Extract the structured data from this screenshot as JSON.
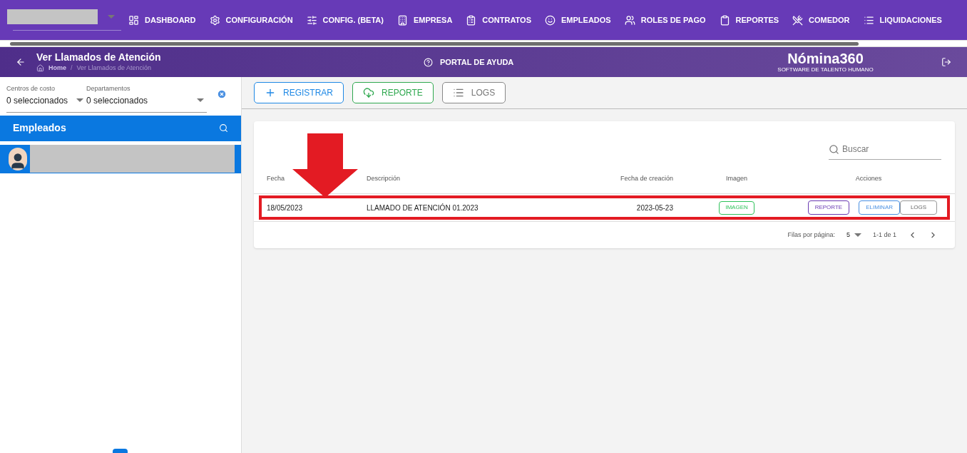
{
  "topbar": {
    "nav": [
      "DASHBOARD",
      "CONFIGURACIÓN",
      "CONFIG. (BETA)",
      "EMPRESA",
      "CONTRATOS",
      "EMPLEADOS",
      "ROLES DE PAGO",
      "REPORTES",
      "COMEDOR",
      "LIQUIDACIONES"
    ]
  },
  "header": {
    "title": "Ver Llamados de Atención",
    "breadcrumb": [
      "Home",
      "Ver Llamados de Atención"
    ],
    "breadcrumb_separator": "/",
    "help": "PORTAL DE AYUDA",
    "logo": "Nómina360",
    "logo_tagline": "SOFTWARE DE TALENTO HUMANO"
  },
  "filters": [
    {
      "label": "Centros de costo",
      "value": "0 seleccionados"
    },
    {
      "label": "Departamentos",
      "value": "0 seleccionados"
    }
  ],
  "sidebar": {
    "title": "Empleados",
    "employees": [
      {
        "selected": true
      }
    ]
  },
  "toolbar": [
    {
      "kind": "add",
      "label": "REGISTRAR"
    },
    {
      "kind": "report",
      "label": "REPORTE"
    },
    {
      "kind": "logs",
      "label": "LOGS"
    }
  ],
  "table": {
    "search": {
      "placeholder": "Buscar"
    },
    "columns": [
      "Fecha",
      "Descripción",
      "Fecha de creación",
      "Imagen",
      "Acciones"
    ],
    "rows": [
      {
        "fecha": "18/05/2023",
        "descripcion": "LLAMADO DE ATENCIÓN 01.2023",
        "creacion": "2023-05-23",
        "imagen": "IMAGEN",
        "actions": [
          "REPORTE",
          "ELIMINAR",
          "LOGS"
        ]
      }
    ],
    "footer": {
      "rows_label": "Filas por página:",
      "rows_value": "5",
      "range": "1-1 de 1"
    }
  }
}
